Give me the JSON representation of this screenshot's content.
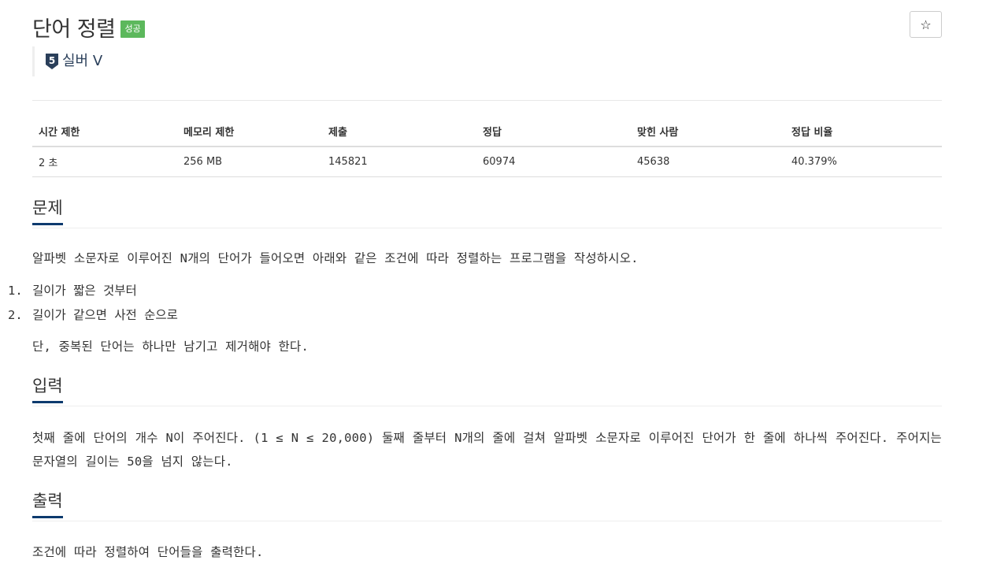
{
  "problem": {
    "title": "단어 정렬",
    "status_badge": "성공",
    "star_icon": "☆",
    "tier": {
      "level_digit": "5",
      "label": "실버 V",
      "color": "#2a3f5a"
    }
  },
  "info_table": {
    "headers": [
      "시간 제한",
      "메모리 제한",
      "제출",
      "정답",
      "맞힌 사람",
      "정답 비율"
    ],
    "values": [
      "2 초",
      "256 MB",
      "145821",
      "60974",
      "45638",
      "40.379%"
    ]
  },
  "sections": {
    "description": {
      "title": "문제",
      "intro": "알파벳 소문자로 이루어진 N개의 단어가 들어오면 아래와 같은 조건에 따라 정렬하는 프로그램을 작성하시오.",
      "conditions": [
        {
          "num": "1.",
          "text": "길이가 짧은 것부터"
        },
        {
          "num": "2.",
          "text": "길이가 같으면 사전 순으로"
        }
      ],
      "note": "단, 중복된 단어는 하나만 남기고 제거해야 한다."
    },
    "input": {
      "title": "입력",
      "text": "첫째 줄에 단어의 개수 N이 주어진다. (1 ≤ N ≤ 20,000) 둘째 줄부터 N개의 줄에 걸쳐 알파벳 소문자로 이루어진 단어가 한 줄에 하나씩 주어진다. 주어지는 문자열의 길이는 50을 넘지 않는다."
    },
    "output": {
      "title": "출력",
      "text": "조건에 따라 정렬하여 단어들을 출력한다."
    }
  },
  "colors": {
    "badge_success": "#5cb85c",
    "section_underline": "#0d3a6e",
    "tier_silver": "#2a3f5a"
  }
}
